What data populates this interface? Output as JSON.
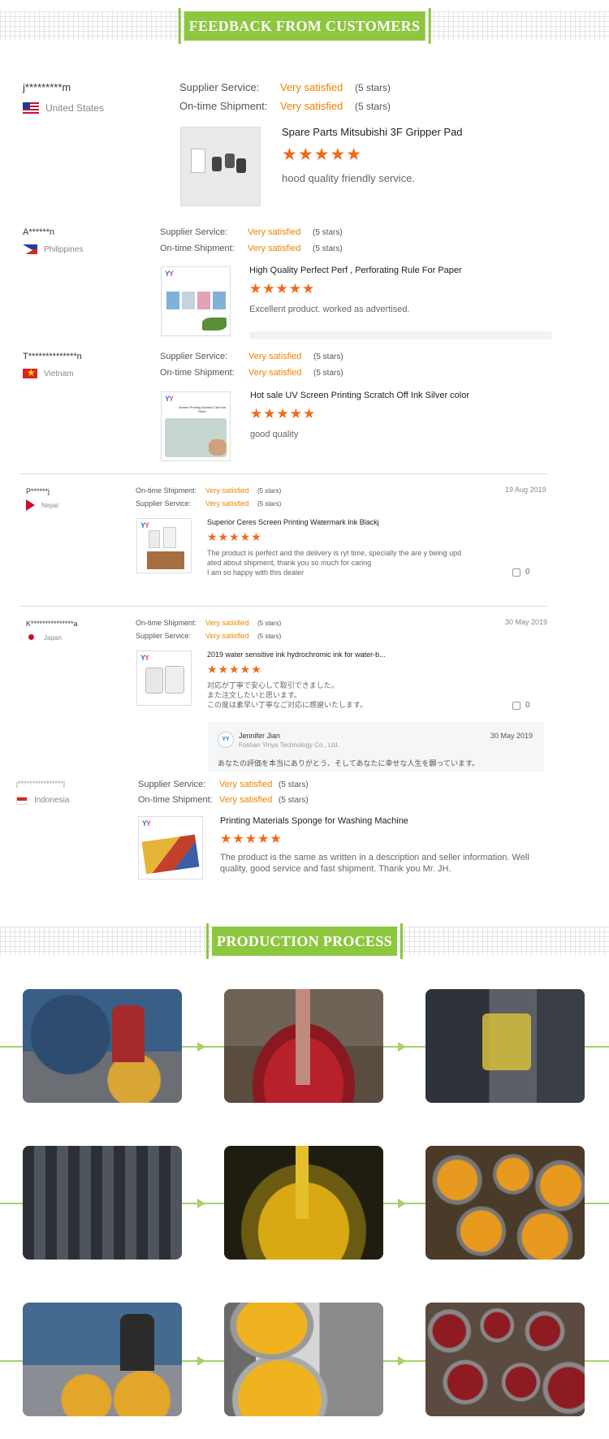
{
  "feedback": {
    "title": "FEEDBACK FROM CUSTOMERS",
    "reviews": [
      {
        "user": "j*********m",
        "country": "United States",
        "supplier_label": "Supplier Service:",
        "supplier_value": "Very satisfied",
        "supplier_count": "(5 stars)",
        "shipment_label": "On-time Shipment:",
        "shipment_value": "Very satisfied",
        "shipment_count": "(5 stars)",
        "product": "Spare Parts Mitsubishi 3F Gripper Pad",
        "stars": "★★★★★",
        "comment": "hood quality friendly service."
      },
      {
        "user": "A******n",
        "country": "Philippines",
        "supplier_label": "Supplier Service:",
        "supplier_value": "Very satisfied",
        "supplier_count": "(5 stars)",
        "shipment_label": "On-time Shipment:",
        "shipment_value": "Very satisfied",
        "shipment_count": "(5 stars)",
        "product": "High Quality Perfect Perf , Perforating Rule For Paper",
        "stars": "★★★★★",
        "comment": "Excellent product. worked as advertised."
      },
      {
        "user": "T**************n",
        "country": "Vietnam",
        "supplier_label": "Supplier Service:",
        "supplier_value": "Very satisfied",
        "supplier_count": "(5 stars)",
        "shipment_label": "On-time Shipment:",
        "shipment_value": "Very satisfied",
        "shipment_count": "(5 stars)",
        "product": "Hot sale UV Screen Printing Scratch Off Ink Silver color",
        "stars": "★★★★★",
        "comment": "good quality",
        "thumb_caption": "Screen Printing Scratch Card Ink Silver"
      },
      {
        "user": "P******j",
        "country": "Nepal",
        "shipment_label": "On-time Shipment:",
        "shipment_value": "Very satisfied",
        "shipment_count": "(5 stars)",
        "supplier_label": "Supplier Service:",
        "supplier_value": "Very satisfied",
        "supplier_count": "(5 stars)",
        "date": "19 Aug 2019",
        "product": "Superior Ceres Screen Printing Watermark Ink Blackj",
        "stars": "★★★★★",
        "comment": "The product is perfect and the delivery is ryt time, specially the are y being upd\nated about shipment, thank you so much for caring\nI am so happy with this dealer",
        "likes": "0"
      },
      {
        "user": "K***************a",
        "country": "Japan",
        "shipment_label": "On-time Shipment:",
        "shipment_value": "Very satisfied",
        "shipment_count": "(5 stars)",
        "supplier_label": "Supplier Service:",
        "supplier_value": "Very satisfied",
        "supplier_count": "(5 stars)",
        "date": "30 May 2019",
        "product": "2019 water sensitive ink hydrochromic ink for water-b...",
        "stars": "★★★★★",
        "comment": "対応が丁寧で安心して取引できました。\nまた注文したいと思います。\nこの度は素早い丁寧なご対応に感謝いたします。",
        "likes": "0",
        "reply": {
          "name": "Jennifer Jian",
          "company": "Foshan Yinya Technology Co., Ltd.",
          "date": "30 May 2019",
          "text": "あなたの評価を本当にありがとう、そしてあなたに幸せな人生を願っています。"
        }
      },
      {
        "user": "j****************j",
        "country": "Indonesia",
        "supplier_label": "Supplier Service:",
        "supplier_value": "Very satisfied",
        "supplier_count": "(5 stars)",
        "shipment_label": "On-time Shipment:",
        "shipment_value": "Very satisfied",
        "shipment_count": "(5 stars)",
        "product": "Printing Materials Sponge for Washing Machine",
        "stars": "★★★★★",
        "comment": "The product is the same as written in a description and seller information. Well\nquality, good service and fast shipment. Thank you Mr. JH."
      }
    ]
  },
  "production": {
    "title": "PRODUCTION PROCESS",
    "photos": [
      {
        "name": "worker-filling-machine",
        "color": "#3a5f86"
      },
      {
        "name": "red-mixing-tank",
        "color": "#b0412c"
      },
      {
        "name": "grinding-mill",
        "color": "#4a4f5a"
      },
      {
        "name": "stacked-cans",
        "color": "#3b4047"
      },
      {
        "name": "yellow-ink-mixer",
        "color": "#c49a12"
      },
      {
        "name": "open-ink-cans-orange",
        "color": "#d88a1c"
      },
      {
        "name": "worker-filling-cans",
        "color": "#446a8f"
      },
      {
        "name": "ceres-ink-cans-yellow",
        "color": "#e6a71c"
      },
      {
        "name": "red-ink-cans",
        "color": "#a3202a"
      }
    ]
  },
  "colors": {
    "accent_green": "#8dc63f",
    "star_orange": "#f06a1a",
    "satisfied_orange": "#f08200"
  }
}
